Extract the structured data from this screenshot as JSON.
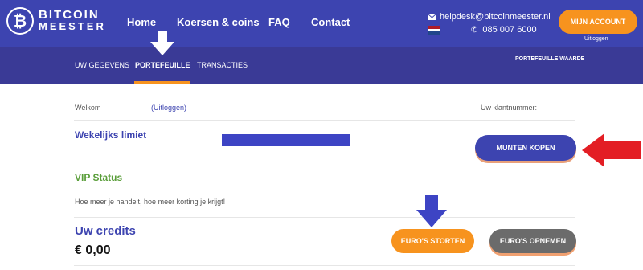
{
  "brand": {
    "logo_symbol": "₿",
    "name_line1": "BITCOIN",
    "name_line2": "MEESTER"
  },
  "main_nav": {
    "items": [
      {
        "label": "Home"
      },
      {
        "label": "Koersen & coins"
      },
      {
        "label": "FAQ"
      },
      {
        "label": "Contact"
      }
    ]
  },
  "contact": {
    "email": "helpdesk@bitcoinmeester.nl",
    "phone": "085 007 6000",
    "mail_icon": "mail-icon",
    "phone_icon": "phone-icon",
    "flag": "nl-flag-icon"
  },
  "account": {
    "button_label": "MIJN ACCOUNT",
    "logout_label": "Uitloggen"
  },
  "sub_nav": {
    "items": [
      {
        "label": "UW GEGEVENS"
      },
      {
        "label": "PORTEFEUILLE"
      },
      {
        "label": "TRANSACTIES"
      }
    ],
    "active": "PORTEFEUILLE",
    "portfolio_value_label": "PORTEFEUILLE WAARDE"
  },
  "welcome": {
    "label": "Welkom",
    "logout_link": "(Uitloggen)",
    "customer_number_label": "Uw klantnummer:"
  },
  "weekly_limit": {
    "title": "Wekelijks limiet",
    "buy_button": "MUNTEN KOPEN"
  },
  "vip": {
    "title": "VIP Status",
    "description": "Hoe meer je handelt, hoe meer korting je krijgt!"
  },
  "credits": {
    "title": "Uw credits",
    "value": "€ 0,00",
    "deposit_button": "EURO'S STORTEN",
    "withdraw_button": "EURO'S OPNEMEN"
  },
  "colors": {
    "header_blue": "#3d44b0",
    "subnav_blue": "#3a3a96",
    "accent_orange": "#f7931e",
    "vip_green": "#5a9e3a",
    "withdraw_gray": "#6b6b6b",
    "annotation_red": "#e31e24"
  }
}
